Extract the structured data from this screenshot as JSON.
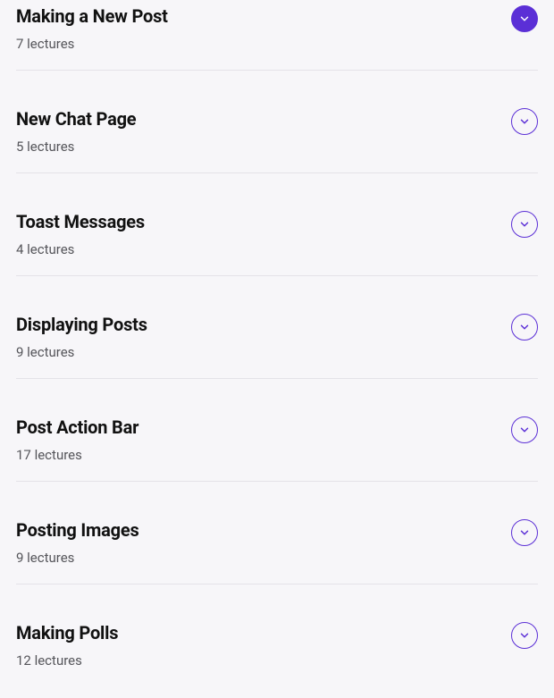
{
  "sections": [
    {
      "title": "Making a New Post",
      "subtitle": "7 lectures",
      "active": true
    },
    {
      "title": "New Chat Page",
      "subtitle": "5 lectures",
      "active": false
    },
    {
      "title": "Toast Messages",
      "subtitle": "4 lectures",
      "active": false
    },
    {
      "title": "Displaying Posts",
      "subtitle": "9 lectures",
      "active": false
    },
    {
      "title": "Post Action Bar",
      "subtitle": "17 lectures",
      "active": false
    },
    {
      "title": "Posting Images",
      "subtitle": "9 lectures",
      "active": false
    },
    {
      "title": "Making Polls",
      "subtitle": "12 lectures",
      "active": false
    }
  ]
}
